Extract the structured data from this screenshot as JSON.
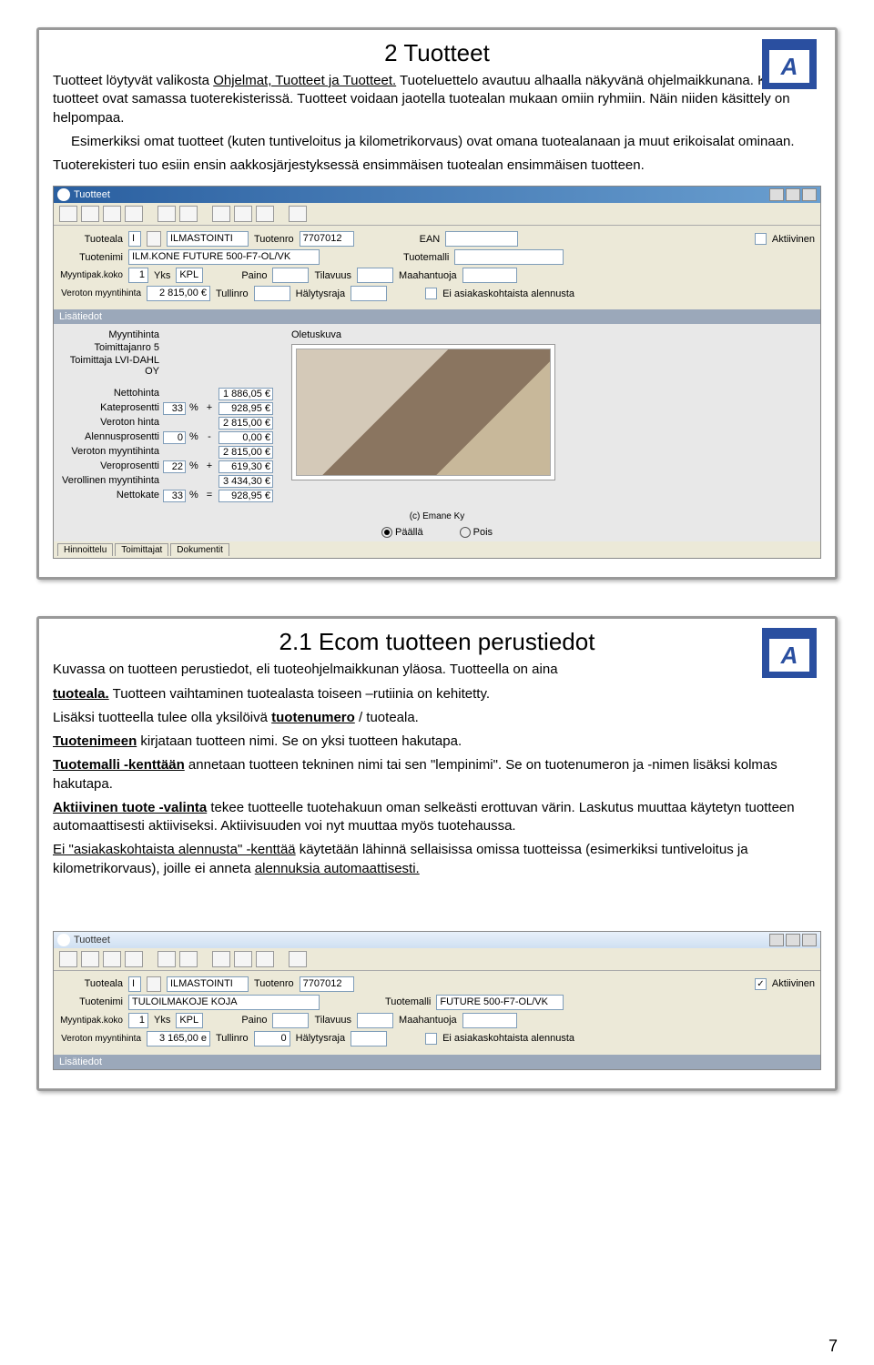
{
  "section1": {
    "title": "2 Tuotteet",
    "para1a": "Tuotteet löytyvät valikosta ",
    "para1b": "Ohjelmat, Tuotteet ja Tuotteet.",
    "para1c": " Tuoteluettelo avautuu alhaalla näkyvänä ohjelmaikkunana. Kaikki tuotteet ovat samassa tuoterekisterissä. Tuotteet voidaan jaotella tuotealan mukaan omiin ryhmiin. Näin niiden käsittely on helpompaa.",
    "para2": "Esimerkiksi omat tuotteet (kuten tuntiveloitus ja kilometrikorvaus) ovat omana tuotealanaan ja muut erikoisalat ominaan.",
    "para3": "Tuoterekisteri tuo esiin ensin aakkosjärjestyksessä ensimmäisen tuotealan ensimmäisen tuotteen."
  },
  "section2": {
    "title": "2.1 Ecom tuotteen perustiedot",
    "p1": "Kuvassa on tuotteen perustiedot, eli tuoteohjelmaikkunan yläosa. Tuotteella on aina",
    "p2a": "tuoteala.",
    "p2b": " Tuotteen vaihtaminen tuotealasta toiseen –rutiinia on kehitetty.",
    "p3a": "Lisäksi tuotteella tulee olla yksilöivä ",
    "p3b": "tuotenumero",
    "p3c": " / tuoteala.",
    "p4a": "Tuotenimeen",
    "p4b": " kirjataan tuotteen nimi. Se on yksi tuotteen hakutapa.",
    "p5a": "Tuotemalli -kenttään",
    "p5b": " annetaan tuotteen tekninen nimi tai sen \"lempinimi\". Se on tuotenumeron ja -nimen lisäksi kolmas hakutapa.",
    "p6a": "Aktiivinen tuote -valinta",
    "p6b": " tekee tuotteelle tuotehakuun oman selkeästi erottuvan värin. Laskutus muuttaa käytetyn tuotteen automaattisesti aktiiviseksi. Aktiivisuuden voi nyt muuttaa myös tuotehaussa.",
    "p7a": "Ei \"asiakaskohtaista alennusta\" -kenttää",
    "p7b": " käytetään lähinnä sellaisissa omissa tuotteissa (esimerkiksi tuntiveloitus ja kilometrikorvaus), joille ei anneta ",
    "p7c": "alennuksia automaattisesti."
  },
  "win1": {
    "title": "Tuotteet",
    "labels": {
      "tuoteala": "Tuoteala",
      "tuotenro": "Tuotenro",
      "ean": "EAN",
      "aktiivinen": "Aktiivinen",
      "tuotenimi": "Tuotenimi",
      "tuotemalli": "Tuotemalli",
      "myyntipak": "Myyntipak.koko",
      "yks": "Yks",
      "paino": "Paino",
      "tilavuus": "Tilavuus",
      "maahantuoja": "Maahantuoja",
      "veroton_myynti": "Veroton myyntihinta",
      "tullinro": "Tullinro",
      "halytysraja": "Hälytysraja",
      "ei_alennus": "Ei asiakaskohtaista alennusta",
      "lisatiedot": "Lisätiedot",
      "myyntihinta": "Myyntihinta",
      "oletuskuva": "Oletuskuva",
      "toimittajanro": "Toimittajanro 5",
      "toimittaja": "Toimittaja LVI-DAHL OY",
      "paalla": "Päällä",
      "pois": "Pois"
    },
    "values": {
      "tuoteala_code": "I",
      "tuoteala_name": "ILMASTOINTI",
      "tuotenro": "7707012",
      "tuotenimi": "ILM.KONE FUTURE 500-F7-OL/VK",
      "myyntipak": "1",
      "yks": "KPL",
      "veroton_myynti": "2 815,00 €"
    },
    "pricing": {
      "rows": [
        {
          "lbl": "Nettohinta",
          "pct": "",
          "op": "",
          "val": "1 886,05 €"
        },
        {
          "lbl": "Kateprosentti",
          "pct": "33",
          "op": "+",
          "val": "928,95 €"
        },
        {
          "lbl": "Veroton hinta",
          "pct": "",
          "op": "",
          "val": "2 815,00 €"
        },
        {
          "lbl": "Alennusprosentti",
          "pct": "0",
          "op": "-",
          "val": "0,00 €"
        },
        {
          "lbl": "Veroton myyntihinta",
          "pct": "",
          "op": "",
          "val": "2 815,00 €"
        },
        {
          "lbl": "Veroprosentti",
          "pct": "22",
          "op": "+",
          "val": "619,30 €"
        },
        {
          "lbl": "Verollinen myyntihinta",
          "pct": "",
          "op": "",
          "val": "3 434,30 €"
        },
        {
          "lbl": "Nettokate",
          "pct": "33",
          "op": "=",
          "val": "928,95 €"
        }
      ]
    },
    "copyright": "(c) Emane Ky",
    "tabs": [
      "Hinnoittelu",
      "Toimittajat",
      "Dokumentit"
    ]
  },
  "win2": {
    "title": "Tuotteet",
    "values": {
      "tuoteala_code": "I",
      "tuoteala_name": "ILMASTOINTI",
      "tuotenro": "7707012",
      "tuotenimi": "TULOILMAKOJE KOJA",
      "tuotemalli": "FUTURE 500-F7-OL/VK",
      "myyntipak": "1",
      "yks": "KPL",
      "veroton_myynti": "3 165,00 e",
      "tullinro": "0"
    }
  },
  "page_number": "7",
  "logo_letter": "A"
}
